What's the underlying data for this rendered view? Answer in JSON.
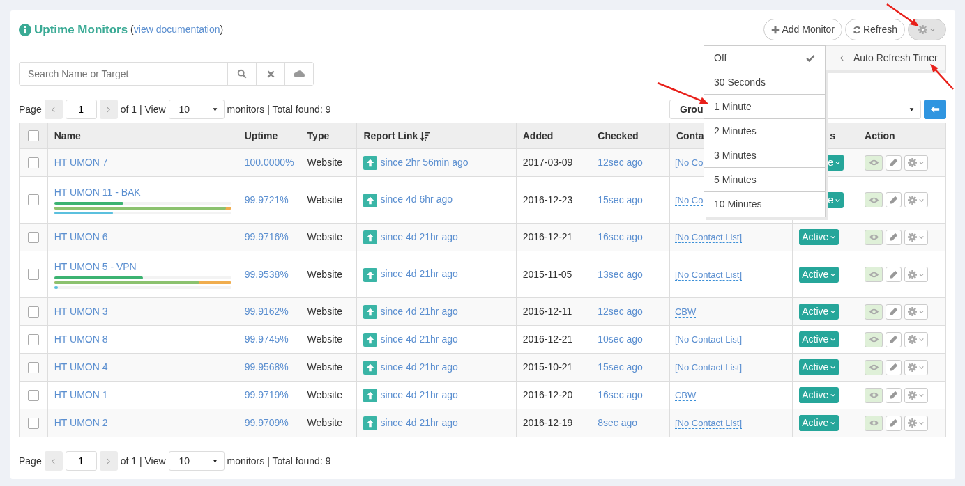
{
  "header": {
    "title": "Uptime Monitors",
    "note_open": "(",
    "note_link": "view documentation",
    "note_close": ")"
  },
  "toolbar": {
    "buttons": [
      {
        "kind": "add",
        "label": "Add Monitor"
      },
      {
        "kind": "refresh",
        "label": "Refresh"
      }
    ],
    "settings_expanded": true
  },
  "search": {
    "placeholder": "Search Name or Target"
  },
  "pager_top": {
    "page_label": "Page",
    "page": "1",
    "of": "of 1 | View",
    "view": "10",
    "summary": "monitors | Total found: 9"
  },
  "group_filter": {
    "label": "Grou"
  },
  "table": {
    "select_all_checked": false,
    "columns": [
      {
        "label": "Name"
      },
      {
        "label": "Uptime"
      },
      {
        "label": "Type"
      },
      {
        "label": "Report Link",
        "sorted": true
      },
      {
        "label": "Added"
      },
      {
        "label": "Checked"
      },
      {
        "label": "Conta"
      },
      {
        "label": "s"
      },
      {
        "label": "Action"
      }
    ],
    "rows": [
      {
        "checked": false,
        "name": "HT UMON 7",
        "uptime": "100.0000%",
        "type": "Website",
        "report": "since 2hr 56min ago",
        "added": "2017-03-09",
        "checked_ago": "12sec ago",
        "contact": "[No Co",
        "status": "e",
        "status_cut": true
      },
      {
        "checked": false,
        "name": "HT UMON 11 - BAK",
        "uptime": "99.9721%",
        "type": "Website",
        "report": "since 4d 6hr ago",
        "added": "2016-12-23",
        "checked_ago": "15sec ago",
        "contact": "[No Co",
        "status": "e",
        "status_cut": true,
        "meters": [
          {
            "level": 0.39,
            "color": "#3cb371"
          },
          {
            "level": 0.97,
            "color": "#8cc26f"
          },
          {
            "level": 0.33,
            "color": "#5bc0de"
          }
        ]
      },
      {
        "checked": false,
        "name": "HT UMON 6",
        "uptime": "99.9716%",
        "type": "Website",
        "report": "since 4d 21hr ago",
        "added": "2016-12-21",
        "checked_ago": "16sec ago",
        "contact": "[No Contact List]",
        "status": "Active",
        "status_cut": false
      },
      {
        "checked": false,
        "name": "HT UMON 5 - VPN",
        "uptime": "99.9538%",
        "type": "Website",
        "report": "since 4d 21hr ago",
        "added": "2015-11-05",
        "checked_ago": "13sec ago",
        "contact": "[No Contact List]",
        "status": "Active",
        "status_cut": false,
        "meters": [
          {
            "level": 0.5,
            "color": "#3cb371"
          },
          {
            "level": 0.82,
            "color": "#8cc26f"
          },
          {
            "level": 0.02,
            "color": "#5bc0de"
          }
        ]
      },
      {
        "checked": false,
        "name": "HT UMON 3",
        "uptime": "99.9162%",
        "type": "Website",
        "report": "since 4d 21hr ago",
        "added": "2016-12-11",
        "checked_ago": "12sec ago",
        "contact": "CBW",
        "status": "Active",
        "status_cut": false
      },
      {
        "checked": false,
        "name": "HT UMON 8",
        "uptime": "99.9745%",
        "type": "Website",
        "report": "since 4d 21hr ago",
        "added": "2016-12-21",
        "checked_ago": "10sec ago",
        "contact": "[No Contact List]",
        "status": "Active",
        "status_cut": false
      },
      {
        "checked": false,
        "name": "HT UMON 4",
        "uptime": "99.9568%",
        "type": "Website",
        "report": "since 4d 21hr ago",
        "added": "2015-10-21",
        "checked_ago": "15sec ago",
        "contact": "[No Contact List]",
        "status": "Active",
        "status_cut": false
      },
      {
        "checked": false,
        "name": "HT UMON 1",
        "uptime": "99.9719%",
        "type": "Website",
        "report": "since 4d 21hr ago",
        "added": "2016-12-20",
        "checked_ago": "16sec ago",
        "contact": "CBW",
        "status": "Active",
        "status_cut": false
      },
      {
        "checked": false,
        "name": "HT UMON 2",
        "uptime": "99.9709%",
        "type": "Website",
        "report": "since 4d 21hr ago",
        "added": "2016-12-19",
        "checked_ago": "8sec ago",
        "contact": "[No Contact List]",
        "status": "Active",
        "status_cut": false
      }
    ]
  },
  "pager_bottom": {
    "page_label": "Page",
    "page": "1",
    "of": "of 1 | View",
    "view": "10",
    "summary": "monitors | Total found: 9"
  },
  "refresh_menu": {
    "title": "Auto Refresh Timer",
    "options": [
      {
        "label": "Off",
        "selected": true
      },
      {
        "label": "30 Seconds",
        "selected": false
      },
      {
        "label": "1 Minute",
        "selected": false
      },
      {
        "label": "2 Minutes",
        "selected": false
      },
      {
        "label": "3 Minutes",
        "selected": false
      },
      {
        "label": "5 Minutes",
        "selected": false
      },
      {
        "label": "10 Minutes",
        "selected": false
      }
    ]
  }
}
